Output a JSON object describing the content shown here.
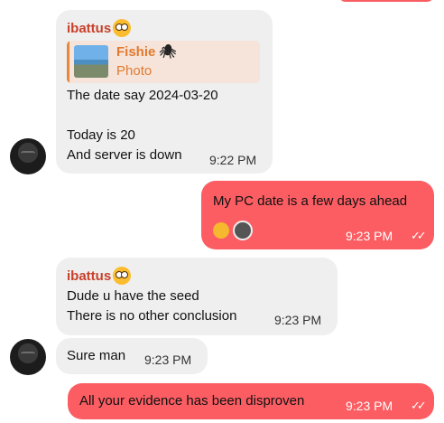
{
  "messages": [
    {
      "sender": "ibattus",
      "reply": {
        "name": "Fishie",
        "type": "Photo"
      },
      "text": "The date say 2024-03-20\n\nToday is 20\nAnd server is down",
      "time": "9:22 PM"
    },
    {
      "text": "My PC date is a few days ahead",
      "time": "9:23 PM"
    },
    {
      "sender": "ibattus",
      "text": "Dude u have the seed\nThere is no other conclusion",
      "time": "9:23 PM"
    },
    {
      "text": "Sure man",
      "time": "9:23 PM"
    },
    {
      "text": "All your evidence has been disproven",
      "time": "9:23 PM"
    }
  ],
  "colors": {
    "outgoing": "#fb5d62",
    "incoming": "#efefef",
    "sender": "#c8402a",
    "reply_accent": "#e8863b"
  },
  "icons": [
    "sender-emoji-icon",
    "spider-icon",
    "rofl-emoji-icon",
    "sticker-emoji-icon",
    "double-check-icon"
  ]
}
